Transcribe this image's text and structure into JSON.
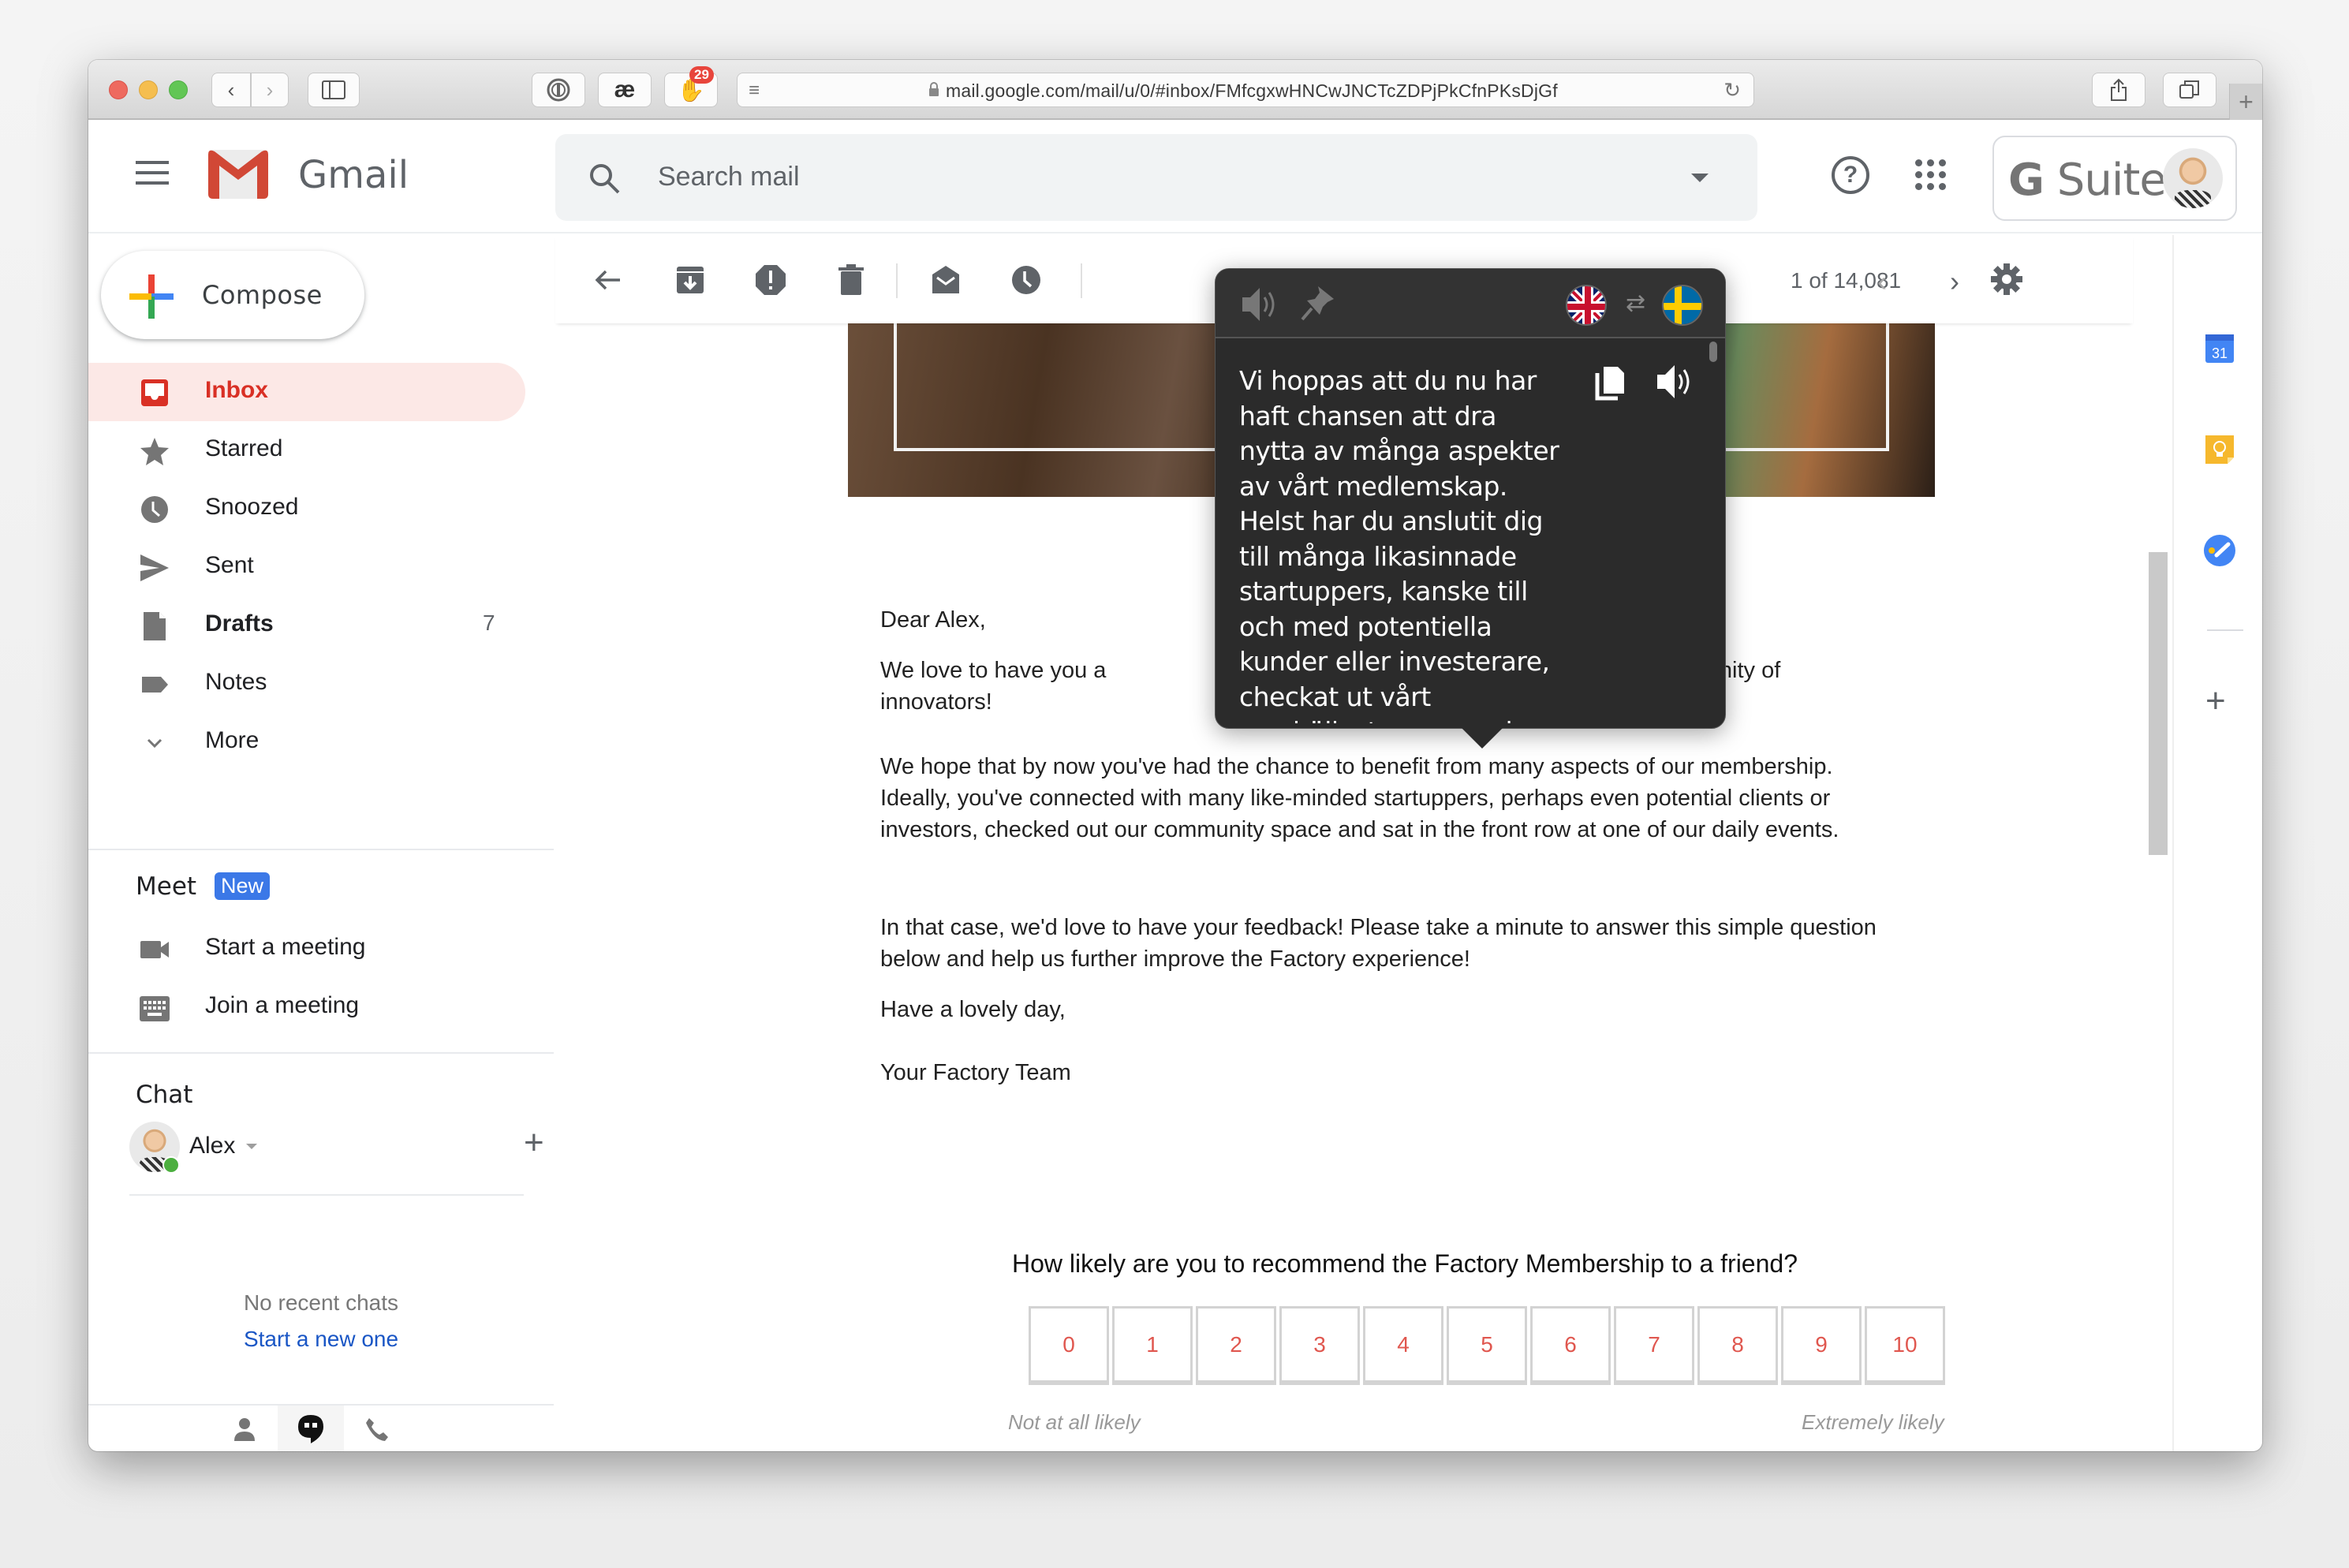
{
  "browser": {
    "url": "mail.google.com/mail/u/0/#inbox/FMfcgxwHNCwJNCTcZDPjPkCfnPKsDjGf",
    "extension_badge_count": "29",
    "extensions": [
      "1password-icon",
      "ae-icon",
      "shaka-icon"
    ]
  },
  "header": {
    "app_name": "Gmail",
    "search_placeholder": "Search mail",
    "brand": {
      "g": "G",
      "suite": "Suite"
    }
  },
  "compose": {
    "label": "Compose"
  },
  "nav": {
    "items": [
      {
        "label": "Inbox",
        "icon": "inbox-icon",
        "active": true,
        "count": ""
      },
      {
        "label": "Starred",
        "icon": "star-icon",
        "count": ""
      },
      {
        "label": "Snoozed",
        "icon": "clock-icon",
        "count": ""
      },
      {
        "label": "Sent",
        "icon": "send-icon",
        "count": ""
      },
      {
        "label": "Drafts",
        "icon": "draft-icon",
        "count": "7",
        "bold": true
      },
      {
        "label": "Notes",
        "icon": "label-icon",
        "count": ""
      },
      {
        "label": "More",
        "icon": "chevron-down-icon",
        "count": ""
      }
    ]
  },
  "meet": {
    "title": "Meet",
    "badge": "New",
    "items": [
      {
        "label": "Start a meeting",
        "icon": "video-camera-icon"
      },
      {
        "label": "Join a meeting",
        "icon": "keyboard-icon"
      }
    ]
  },
  "chat": {
    "title": "Chat",
    "user": "Alex",
    "empty_text": "No recent chats",
    "start_link": "Start a new one"
  },
  "toolbar": {
    "pager": "1 of 14,081"
  },
  "email": {
    "greeting": "Dear Alex,",
    "paragraph1_left": "We love to have you a",
    "paragraph1_right": "n to our community of",
    "paragraph1_line2": "innovators!",
    "paragraph2": "We hope that by now you've had the chance to benefit from many aspects of our membership. Ideally, you've connected with many like-minded startuppers, perhaps even potential clients or investors, checked out our community space and sat in the front row at one of our daily events.",
    "paragraph3": "In that case, we'd love to have your feedback! Please take a minute to answer this simple question below and help us further improve the Factory experience!",
    "closing": "Have a lovely day,",
    "signature": "Your Factory Team",
    "nps": {
      "question": "How likely are you to recommend the Factory Membership to a friend?",
      "scale": [
        "0",
        "1",
        "2",
        "3",
        "4",
        "5",
        "6",
        "7",
        "8",
        "9",
        "10"
      ],
      "low_label": "Not at all likely",
      "high_label": "Extremely likely"
    }
  },
  "translator": {
    "source_lang": "English",
    "target_lang": "Swedish",
    "translation": "Vi hoppas att du nu har haft chansen att dra nytta av många aspekter av vårt medlemskap. Helst har du anslutit dig till många likasinnade startuppers, kanske till och med potentiella kunder eller investerare, checkat ut vårt samhällsutrymme och"
  },
  "side_panel": {
    "calendar_day": "31",
    "apps": [
      "calendar-icon",
      "keep-icon",
      "tasks-icon"
    ]
  },
  "colors": {
    "gmail_red": "#d93025",
    "active_bg": "#fce8e6",
    "link_blue": "#1a56c5",
    "badge_blue": "#3b78e7",
    "nps_number": "#e0574f",
    "popup_bg": "#2b2b2b"
  }
}
